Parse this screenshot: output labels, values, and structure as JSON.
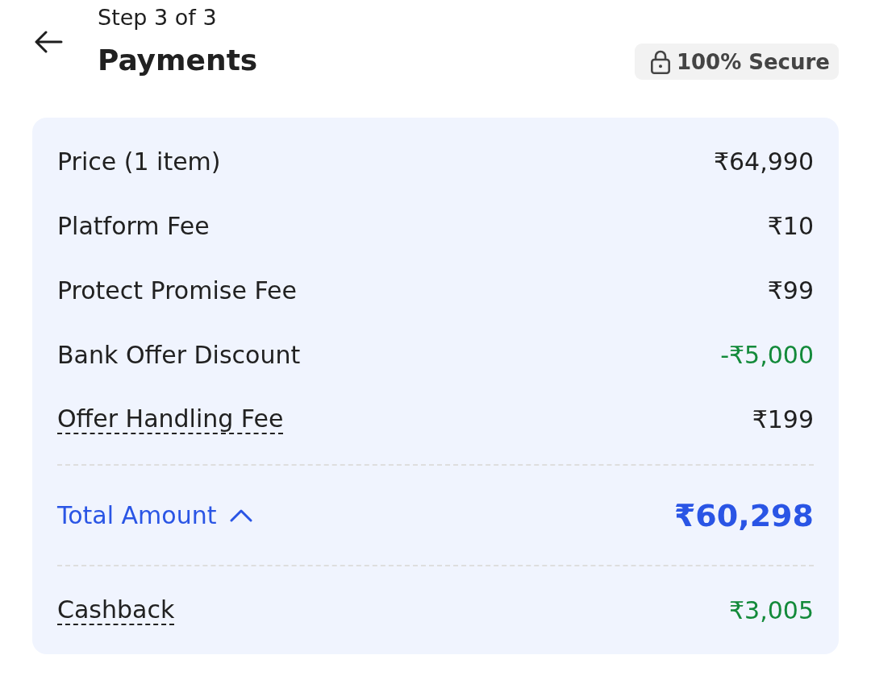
{
  "header": {
    "step": "Step 3 of 3",
    "title": "Payments",
    "secure_badge": "100% Secure"
  },
  "summary": {
    "rows": [
      {
        "label": "Price (1 item)",
        "value": "₹64,990",
        "kind": "plain"
      },
      {
        "label": "Platform Fee",
        "value": "₹10",
        "kind": "plain"
      },
      {
        "label": "Protect Promise Fee",
        "value": "₹99",
        "kind": "plain"
      },
      {
        "label": "Bank Offer Discount",
        "value": "-₹5,000",
        "kind": "discount"
      },
      {
        "label": "Offer Handling Fee",
        "value": "₹199",
        "kind": "info"
      }
    ],
    "total": {
      "label": "Total Amount",
      "value": "₹60,298",
      "expanded": true
    },
    "cashback": {
      "label": "Cashback",
      "value": "₹3,005"
    }
  }
}
